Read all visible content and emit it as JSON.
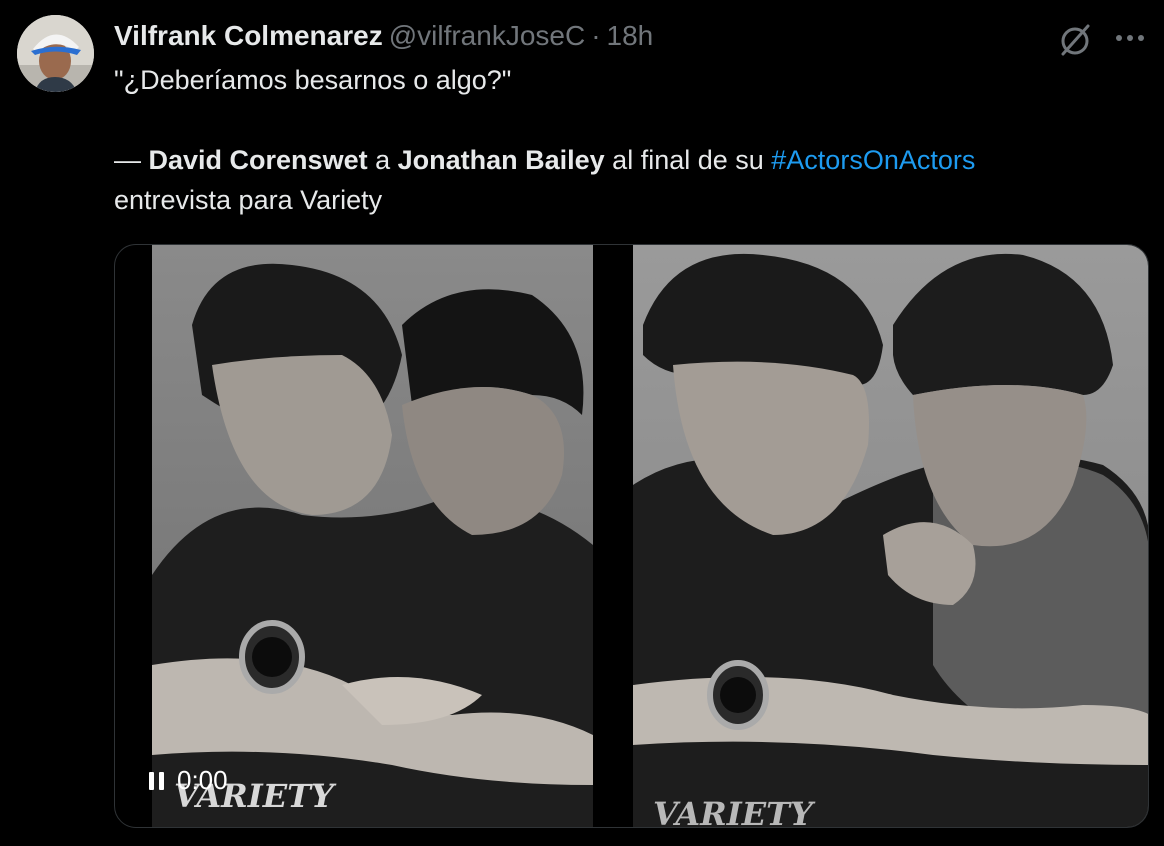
{
  "author": {
    "display_name": "Vilfrank Colmenarez",
    "handle": "@vilfrankJoseC",
    "separator": "·",
    "time": "18h"
  },
  "tweet": {
    "line1": "\"¿Deberíamos besarnos o algo?\"",
    "prefix": "— ",
    "name1": "David Corenswet",
    "connector": " a ",
    "name2": "Jonathan Bailey",
    "middle": " al final de su ",
    "hashtag": "#ActorsOnActors",
    "line4": "entrevista para Variety"
  },
  "media": {
    "watermark_left": "VARIETY",
    "watermark_right": "VARIETY",
    "video_time": "0:00"
  },
  "icons": {
    "grok": "grok-icon",
    "more": "more-icon",
    "pause": "pause-icon"
  },
  "colors": {
    "background": "#000000",
    "text": "#e7e9ea",
    "secondary": "#71767b",
    "hashtag": "#1d9bf0",
    "border": "#2f3336"
  }
}
